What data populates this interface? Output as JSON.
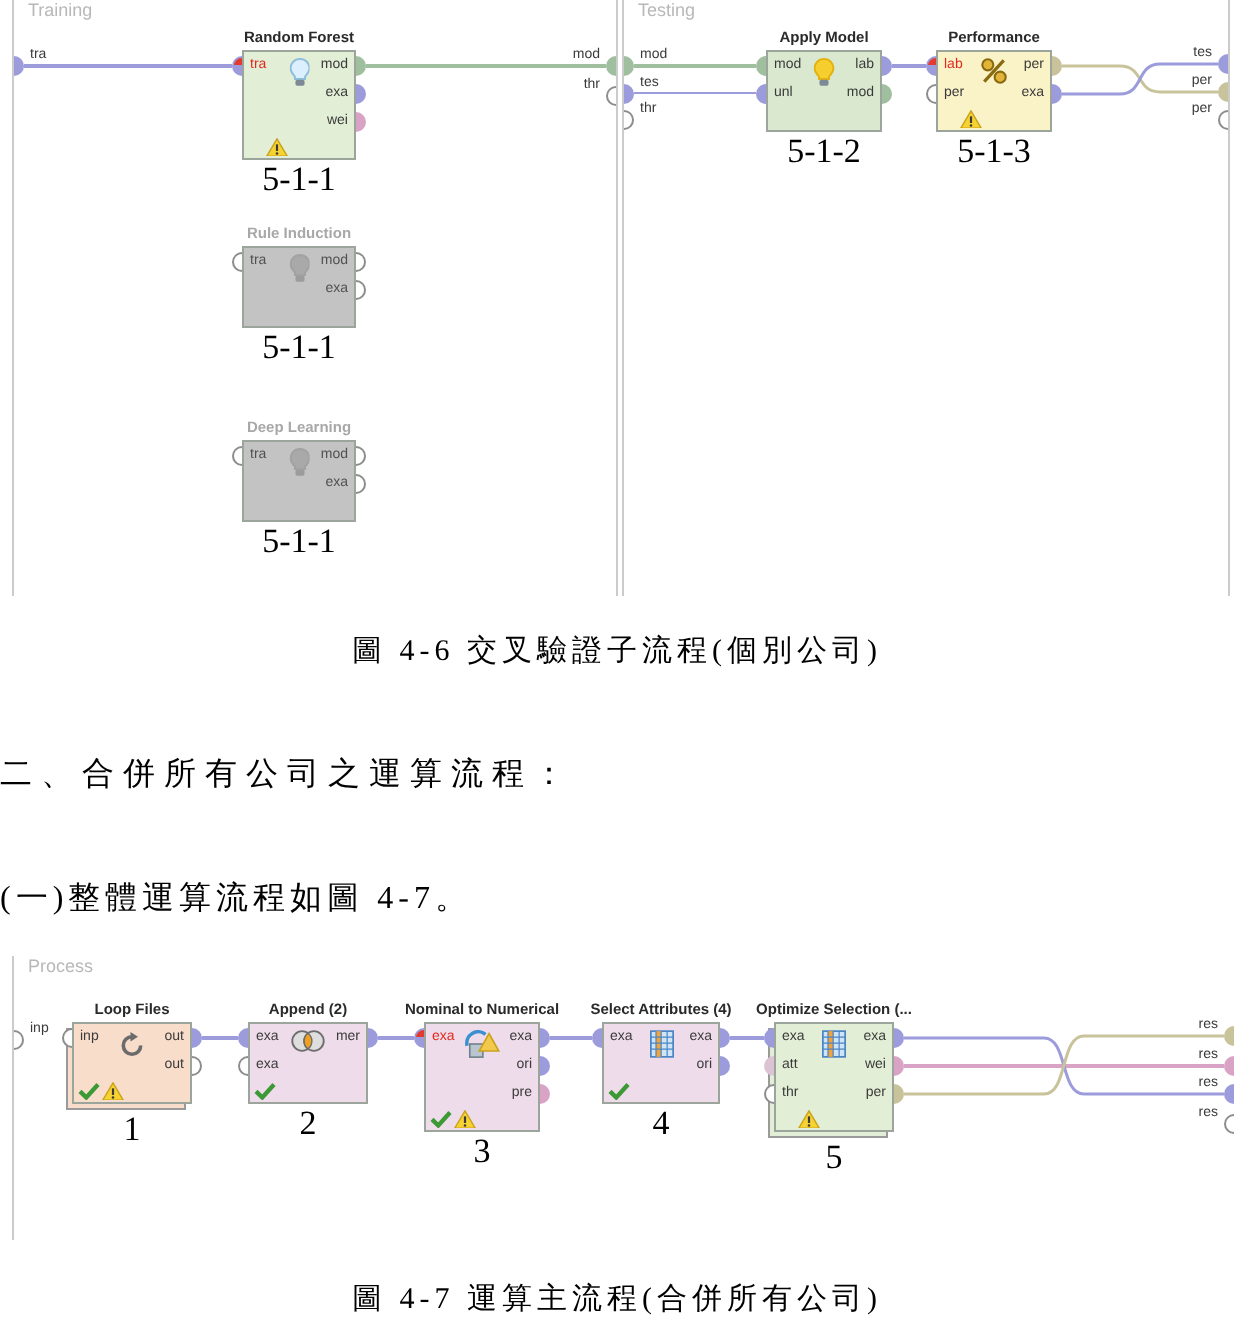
{
  "figure_4_6": {
    "panels": [
      {
        "title": "Training",
        "inputs": [
          {
            "label": "tra",
            "color": "#9c9cdc"
          }
        ],
        "outputs": [
          {
            "label": "mod",
            "color": "#9fbf9f"
          },
          {
            "label": "thr"
          }
        ],
        "operators": [
          {
            "name": "Random Forest",
            "kind": "learner",
            "enabled": true,
            "color": "#e2eed6",
            "stacked": false,
            "check": false,
            "warning": true,
            "tag": "5-1-1",
            "in_ports": [
              {
                "label": "tra",
                "color": "#9c9cdc",
                "error": true
              }
            ],
            "out_ports": [
              {
                "label": "mod",
                "color": "#9fbf9f",
                "error": false
              },
              {
                "label": "exa",
                "color": "#9c9cdc",
                "error": false
              },
              {
                "label": "wei",
                "color": "#d9a3c6",
                "error": false
              }
            ]
          },
          {
            "name": "Rule Induction",
            "kind": "learner",
            "enabled": false,
            "stacked": false,
            "check": false,
            "warning": false,
            "tag": "5-1-1",
            "in_ports": [
              {
                "label": "tra",
                "error": false
              }
            ],
            "out_ports": [
              {
                "label": "mod",
                "error": false
              },
              {
                "label": "exa",
                "error": false
              }
            ]
          },
          {
            "name": "Deep Learning",
            "kind": "learner",
            "enabled": false,
            "stacked": false,
            "check": false,
            "warning": false,
            "tag": "5-1-1",
            "in_ports": [
              {
                "label": "tra",
                "error": false
              }
            ],
            "out_ports": [
              {
                "label": "mod",
                "error": false
              },
              {
                "label": "exa",
                "error": false
              }
            ]
          }
        ]
      },
      {
        "title": "Testing",
        "inputs": [
          {
            "label": "mod",
            "color": "#9fbf9f"
          },
          {
            "label": "tes",
            "color": "#9c9cdc"
          },
          {
            "label": "thr"
          }
        ],
        "outputs": [
          {
            "label": "tes",
            "color": "#9c9cdc"
          },
          {
            "label": "per",
            "color": "#c8c39a"
          },
          {
            "label": "per"
          }
        ],
        "operators": [
          {
            "name": "Apply Model",
            "kind": "applier",
            "enabled": true,
            "color": "#dae8d0",
            "stacked": false,
            "check": false,
            "warning": false,
            "tag": "5-1-2",
            "in_ports": [
              {
                "label": "mod",
                "color": "#9fbf9f",
                "error": false
              },
              {
                "label": "unl",
                "color": "#9c9cdc",
                "error": false
              }
            ],
            "out_ports": [
              {
                "label": "lab",
                "color": "#9c9cdc",
                "error": false
              },
              {
                "label": "mod",
                "color": "#9fbf9f",
                "error": false
              }
            ]
          },
          {
            "name": "Performance",
            "kind": "performance",
            "enabled": true,
            "color": "#fbf3c8",
            "stacked": false,
            "check": false,
            "warning": true,
            "tag": "5-1-3",
            "in_ports": [
              {
                "label": "lab",
                "color": "#9c9cdc",
                "error": true
              },
              {
                "label": "per",
                "error": false
              }
            ],
            "out_ports": [
              {
                "label": "per",
                "color": "#c8c39a",
                "error": false
              },
              {
                "label": "exa",
                "color": "#9c9cdc",
                "error": false
              }
            ]
          }
        ]
      }
    ],
    "caption": "圖 4-6 交叉驗證子流程(個別公司)"
  },
  "heading": "二、合併所有公司之運算流程：",
  "paragraph": "(一)整體運算流程如圖 4-7。",
  "figure_4_7": {
    "panel": {
      "title": "Process",
      "inputs": [
        {
          "label": "inp"
        }
      ],
      "outputs": [
        {
          "label": "res",
          "color": "#c8c39a"
        },
        {
          "label": "res",
          "color": "#d9a3c6"
        },
        {
          "label": "res",
          "color": "#9c9cdc"
        },
        {
          "label": "res"
        }
      ],
      "operators": [
        {
          "name": "Loop Files",
          "kind": "loop",
          "enabled": true,
          "color": "#f8ddcb",
          "stacked": true,
          "check": true,
          "warning": true,
          "tag": "1",
          "in_ports": [
            {
              "label": "inp",
              "error": false
            }
          ],
          "out_ports": [
            {
              "label": "out",
              "color": "#9c9cdc",
              "error": false
            },
            {
              "label": "out",
              "error": false
            }
          ]
        },
        {
          "name": "Append (2)",
          "kind": "append",
          "enabled": true,
          "color": "#efdcea",
          "stacked": false,
          "check": true,
          "warning": false,
          "tag": "2",
          "in_ports": [
            {
              "label": "exa",
              "color": "#9c9cdc",
              "error": false
            },
            {
              "label": "exa",
              "error": false
            }
          ],
          "out_ports": [
            {
              "label": "mer",
              "color": "#9c9cdc",
              "error": false
            }
          ]
        },
        {
          "name": "Nominal to Numerical",
          "kind": "conversion",
          "enabled": true,
          "color": "#efdcea",
          "stacked": false,
          "check": true,
          "warning": true,
          "tag": "3",
          "in_ports": [
            {
              "label": "exa",
              "color": "#9c9cdc",
              "error": true
            }
          ],
          "out_ports": [
            {
              "label": "exa",
              "color": "#9c9cdc",
              "error": false
            },
            {
              "label": "ori",
              "color": "#9c9cdc",
              "error": false
            },
            {
              "label": "pre",
              "color": "#d9a3c6",
              "error": false
            }
          ]
        },
        {
          "name": "Select Attributes (4)",
          "kind": "selection",
          "enabled": true,
          "color": "#efdcea",
          "stacked": false,
          "check": true,
          "warning": false,
          "tag": "4",
          "in_ports": [
            {
              "label": "exa",
              "color": "#9c9cdc",
              "error": false
            }
          ],
          "out_ports": [
            {
              "label": "exa",
              "color": "#9c9cdc",
              "error": false
            },
            {
              "label": "ori",
              "color": "#9c9cdc",
              "error": false
            }
          ]
        },
        {
          "name": "Optimize Selection (...",
          "kind": "selection",
          "enabled": true,
          "color": "#e2eed6",
          "stacked": true,
          "check": false,
          "warning": true,
          "tag": "5",
          "in_ports": [
            {
              "label": "exa",
              "color": "#9c9cdc",
              "error": false
            },
            {
              "label": "att",
              "color": "#dcc3d3",
              "error": false
            },
            {
              "label": "thr",
              "error": false
            }
          ],
          "out_ports": [
            {
              "label": "exa",
              "color": "#9c9cdc",
              "error": false
            },
            {
              "label": "wei",
              "color": "#d9a3c6",
              "error": false
            },
            {
              "label": "per",
              "color": "#c8c39a",
              "error": false
            }
          ]
        }
      ]
    },
    "caption": "圖 4-7 運算主流程(合併所有公司)"
  }
}
